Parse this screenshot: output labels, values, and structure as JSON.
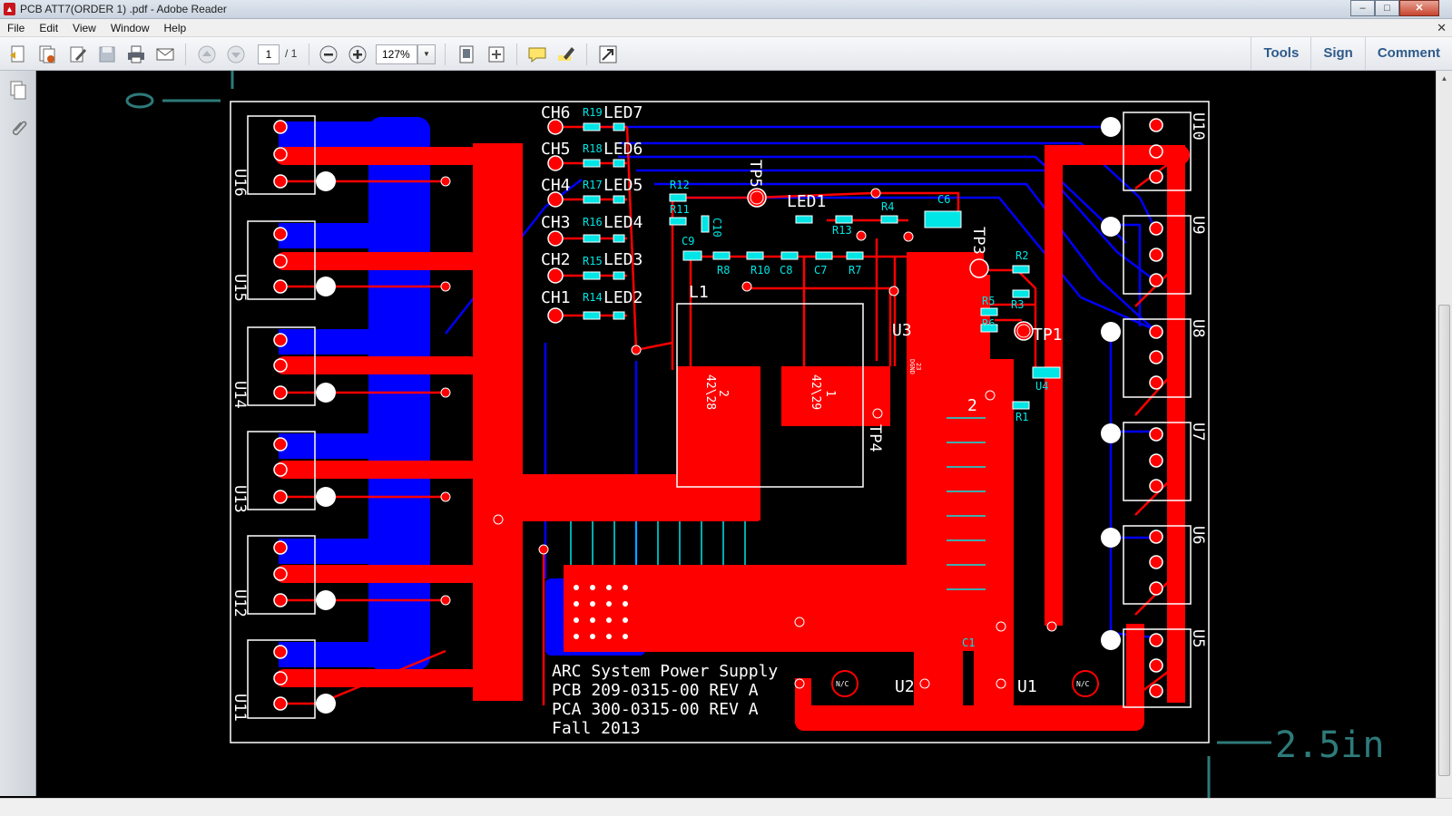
{
  "window": {
    "title": "PCB ATT7(ORDER 1) .pdf - Adobe Reader",
    "app_icon": "pdf-icon",
    "buttons": {
      "minimize": "–",
      "maximize": "□",
      "close": "✕"
    }
  },
  "menu": {
    "items": [
      "File",
      "Edit",
      "View",
      "Window",
      "Help"
    ],
    "close_glyph": "✕"
  },
  "toolbar": {
    "page_current": "1",
    "page_total": "/ 1",
    "zoom": "127%",
    "zoom_arrow": "▼",
    "tools_label": "Tools",
    "sign_label": "Sign",
    "comment_label": "Comment",
    "icons": [
      "create-pdf-icon",
      "combine-files-icon",
      "edit-pdf-icon",
      "save-icon",
      "print-icon",
      "email-icon",
      "page-up-icon",
      "page-down-icon",
      "zoom-out-icon",
      "zoom-in-icon",
      "fit-page-icon",
      "full-width-icon",
      "add-comment-icon",
      "highlight-icon",
      "full-screen-icon"
    ]
  },
  "colors": {
    "copper_top": "#ff0000",
    "copper_bottom": "#0000ff",
    "silkscreen": "#ffffff",
    "component_labels": "#00e5e5",
    "dimension": "#2e7a7a"
  },
  "pcb": {
    "title_lines": [
      "ARC System Power Supply",
      "PCB 209-0315-00 REV A",
      "PCA 300-0315-00 REV A",
      "Fall 2013"
    ],
    "dimension_label": "2.5in",
    "connectors_left": [
      "U16",
      "U15",
      "U14",
      "U13",
      "U12",
      "U11"
    ],
    "connectors_right": [
      "U10",
      "U9",
      "U8",
      "U7",
      "U6",
      "U5"
    ],
    "channels": [
      "CH6",
      "CH5",
      "CH4",
      "CH3",
      "CH2",
      "CH1"
    ],
    "channel_resistors": [
      "R19",
      "R18",
      "R17",
      "R16",
      "R15",
      "R14"
    ],
    "leds": [
      "LED7",
      "LED6",
      "LED5",
      "LED4",
      "LED3",
      "LED2"
    ],
    "led1": "LED1",
    "test_points": {
      "tp5": "TP5",
      "tp3": "TP3",
      "tp4": "TP4",
      "tp1": "TP1"
    },
    "parts": {
      "r12": "R12",
      "r11": "R11",
      "c10": "C10",
      "c9": "C9",
      "r8": "R8",
      "r10": "R10",
      "c8": "C8",
      "c7": "C7",
      "r7": "R7",
      "r13": "R13",
      "r4": "R4",
      "c6": "C6",
      "r2": "R2",
      "r3": "R3",
      "r5": "R5",
      "r6": "R6",
      "r1": "R1",
      "l1": "L1",
      "u3": "U3",
      "u4": "U4",
      "u2": "U2",
      "u1": "U1",
      "c1": "C1",
      "two": "2"
    },
    "big_pad_1": {
      "pin": "2",
      "net": "42\\28"
    },
    "big_pad_2": {
      "pin": "1",
      "net": "42\\29"
    },
    "ic_label_1": "23",
    "ic_label_2": "DGND",
    "nc_label": "N/C"
  }
}
